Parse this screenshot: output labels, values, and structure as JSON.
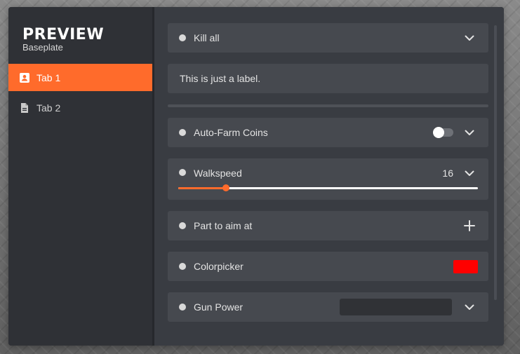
{
  "brand": {
    "title": "PREVIEW",
    "subtitle": "Baseplate"
  },
  "tabs": [
    {
      "label": "Tab 1",
      "icon": "contact-icon",
      "active": true
    },
    {
      "label": "Tab 2",
      "icon": "document-icon",
      "active": false
    }
  ],
  "items": {
    "kill_all": {
      "label": "Kill all"
    },
    "label_box": {
      "text": "This is just a label."
    },
    "auto_farm": {
      "label": "Auto-Farm Coins",
      "enabled": false
    },
    "walkspeed": {
      "label": "Walkspeed",
      "value": "16",
      "fill_fraction": 0.16
    },
    "aim_part": {
      "label": "Part to aim at"
    },
    "colorpicker": {
      "label": "Colorpicker",
      "color": "#ff0000"
    },
    "gun_power": {
      "label": "Gun Power",
      "value": ""
    }
  },
  "colors": {
    "accent": "#ff6b2b",
    "panel": "#46494f",
    "background": "#393c42",
    "sidebar": "#2f3136"
  }
}
